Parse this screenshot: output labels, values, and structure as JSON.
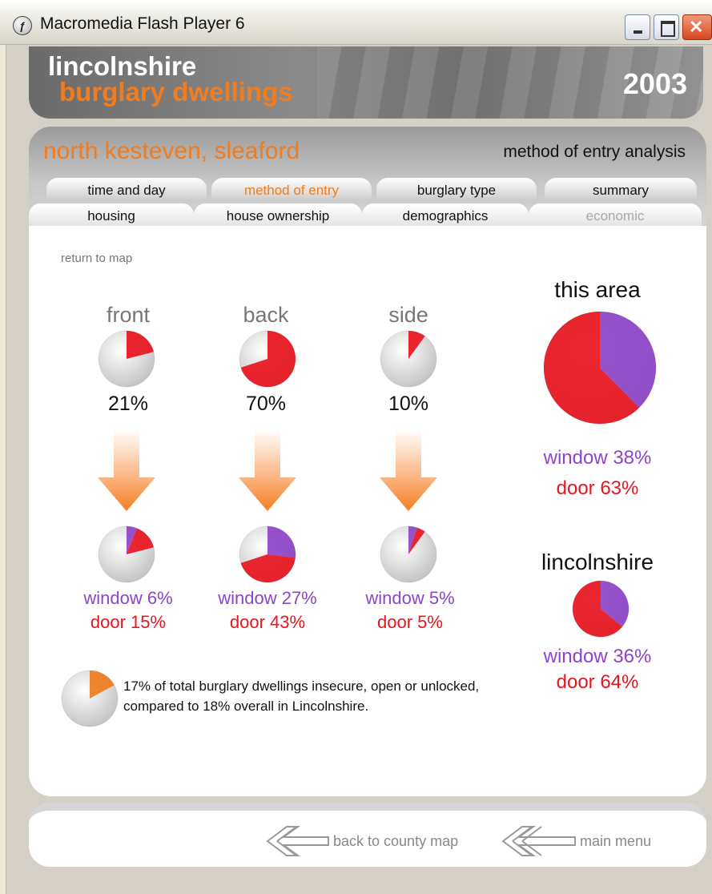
{
  "window": {
    "title": "Macromedia Flash Player 6"
  },
  "header": {
    "title": "lincolnshire",
    "subtitle": "burglary dwellings",
    "year": "2003"
  },
  "panel": {
    "area_name": "north kesteven, sleaford",
    "analysis_title": "method of entry analysis"
  },
  "tabs_back": [
    {
      "label": "time and day",
      "state": "normal"
    },
    {
      "label": "method of entry",
      "state": "active"
    },
    {
      "label": "burglary type",
      "state": "normal"
    },
    {
      "label": "summary",
      "state": "normal"
    }
  ],
  "tabs_front": [
    {
      "label": "housing",
      "state": "normal"
    },
    {
      "label": "house ownership",
      "state": "normal"
    },
    {
      "label": "demographics",
      "state": "normal"
    },
    {
      "label": "economic",
      "state": "disabled"
    }
  ],
  "content": {
    "return_link": "return to map",
    "columns": [
      {
        "label": "front",
        "percent": "21%",
        "window": "window 6%",
        "door": "door 15%"
      },
      {
        "label": "back",
        "percent": "70%",
        "window": "window 27%",
        "door": "door 43%"
      },
      {
        "label": "side",
        "percent": "10%",
        "window": "window 5%",
        "door": "door 5%"
      }
    ],
    "this_area": {
      "title": "this area",
      "window": "window 38%",
      "door": "door 63%"
    },
    "lincolnshire": {
      "title": "lincolnshire",
      "window": "window 36%",
      "door": "door 64%"
    },
    "note": "17% of total burglary dwellings insecure, open or unlocked, compared to 18% overall in Lincolnshire."
  },
  "chart_data": {
    "type": "pie",
    "groups": [
      {
        "label": "front",
        "total": 21,
        "window": 6,
        "door": 15
      },
      {
        "label": "back",
        "total": 70,
        "window": 27,
        "door": 43
      },
      {
        "label": "side",
        "total": 10,
        "window": 5,
        "door": 5
      },
      {
        "label": "this area",
        "window": 38,
        "door": 63
      },
      {
        "label": "lincolnshire",
        "window": 36,
        "door": 64
      },
      {
        "label": "insecure",
        "total": 17
      }
    ]
  },
  "footer": {
    "back_label": "back to county map",
    "menu_label": "main menu"
  },
  "colors": {
    "accent": "#f07c1e",
    "window": "#8e44c8",
    "door": "#e8141e"
  }
}
